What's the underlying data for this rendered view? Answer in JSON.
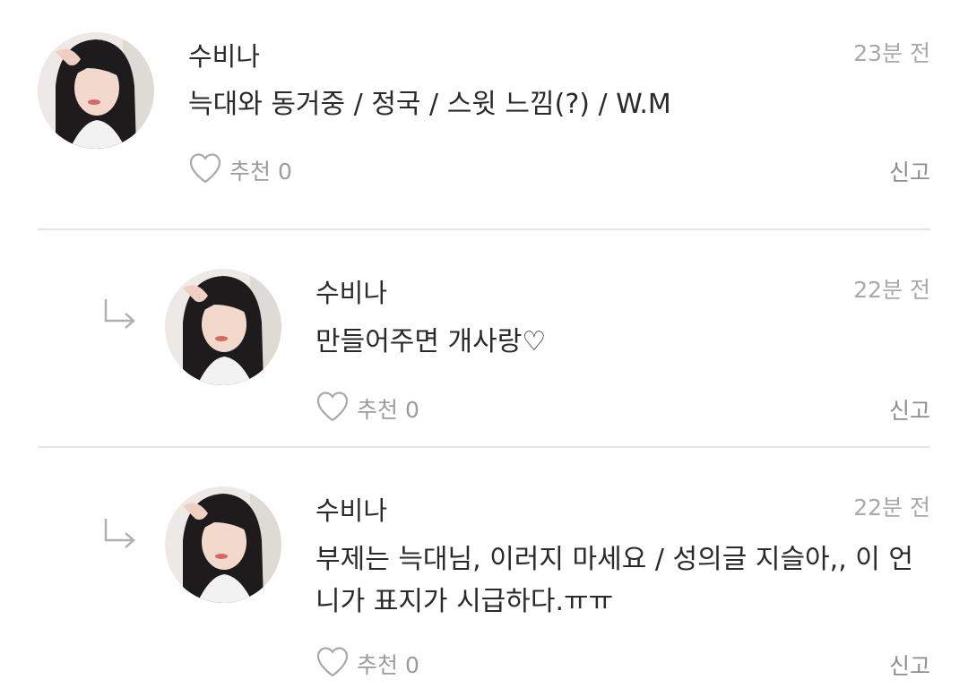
{
  "comments": [
    {
      "author": "수비나",
      "time": "23분 전",
      "text": "늑대와 동거중 / 정국 / 스윗 느낌(?) / W.M",
      "like_label": "추천 0",
      "report_label": "신고",
      "is_reply": false
    },
    {
      "author": "수비나",
      "time": "22분 전",
      "text": "만들어주면 개사랑♡",
      "like_label": "추천 0",
      "report_label": "신고",
      "is_reply": true
    },
    {
      "author": "수비나",
      "time": "22분 전",
      "text": "부제는 늑대님, 이러지 마세요 / 성의글 지슬아,, 이 언니가 표지가 시급하다.ㅠㅠ",
      "like_label": "추천 0",
      "report_label": "신고",
      "is_reply": true
    }
  ],
  "icons": {
    "like": "heart-outline-icon",
    "reply": "reply-arrow-icon"
  },
  "colors": {
    "text": "#2a2a2a",
    "muted": "#a9a9a9",
    "divider": "#e5e5e5"
  }
}
